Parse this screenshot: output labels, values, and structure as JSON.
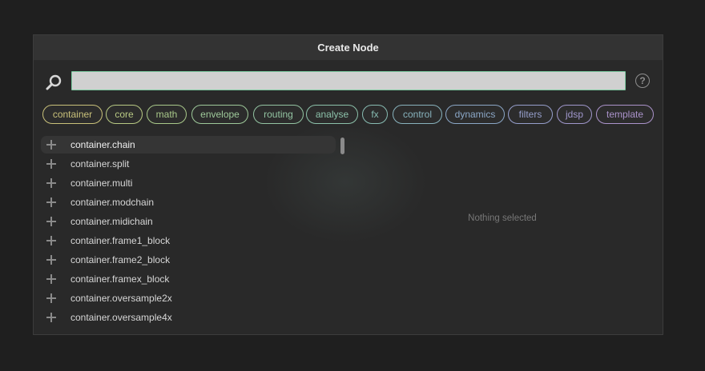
{
  "dialog": {
    "title": "Create Node"
  },
  "search": {
    "value": "",
    "placeholder": ""
  },
  "help": {
    "label": "?"
  },
  "tags": [
    {
      "label": "container",
      "color": "#c9c17a"
    },
    {
      "label": "core",
      "color": "#b8c983"
    },
    {
      "label": "math",
      "color": "#a9c98a"
    },
    {
      "label": "envelope",
      "color": "#9ec99a"
    },
    {
      "label": "routing",
      "color": "#93c4a2"
    },
    {
      "label": "analyse",
      "color": "#8cc2aa"
    },
    {
      "label": "fx",
      "color": "#88bdb3"
    },
    {
      "label": "control",
      "color": "#88b3bd"
    },
    {
      "label": "dynamics",
      "color": "#8ba7c7"
    },
    {
      "label": "filters",
      "color": "#969fcc"
    },
    {
      "label": "jdsp",
      "color": "#a097cc"
    },
    {
      "label": "template",
      "color": "#ab93cb"
    }
  ],
  "nodes": [
    {
      "label": "container.chain",
      "selected": true
    },
    {
      "label": "container.split"
    },
    {
      "label": "container.multi"
    },
    {
      "label": "container.modchain"
    },
    {
      "label": "container.midichain"
    },
    {
      "label": "container.frame1_block"
    },
    {
      "label": "container.frame2_block"
    },
    {
      "label": "container.framex_block"
    },
    {
      "label": "container.oversample2x"
    },
    {
      "label": "container.oversample4x"
    }
  ],
  "preview": {
    "empty_text": "Nothing selected"
  }
}
